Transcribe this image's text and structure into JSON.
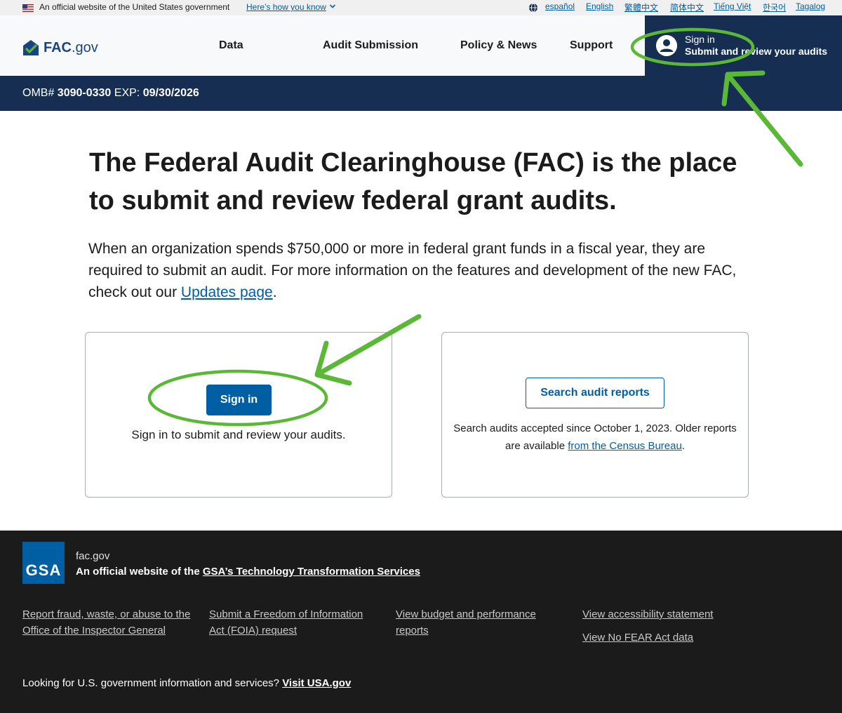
{
  "gov_banner": {
    "text": "An official website of the United States government",
    "link": "Here’s how you know",
    "languages": [
      "español",
      "English",
      "繁體中文",
      "简体中文",
      "Tiếng Việt",
      "한국어",
      "Tagalog"
    ]
  },
  "header": {
    "logo_main": "FAC",
    "logo_suffix": ".gov",
    "nav": [
      "Data",
      "Audit Submission",
      "Policy & News",
      "Support"
    ],
    "signin_line1": "Sign in",
    "signin_line2": "Submit and review your audits"
  },
  "omb": {
    "label": "OMB#",
    "number": "3090-0330",
    "exp_label": "EXP:",
    "exp_date": "09/30/2026"
  },
  "main": {
    "headline": "The Federal Audit Clearinghouse (FAC) is the place to submit and review federal grant audits.",
    "intro_text": "When an organization spends $750,000 or more in federal grant funds in a fiscal year, they are required to submit an audit. For more information on the features and development of the new FAC, check out our",
    "intro_link": "Updates page",
    "intro_end": ".",
    "signin_card": {
      "button": "Sign in",
      "text": "Sign in to submit and review your audits."
    },
    "search_card": {
      "button": "Search audit reports",
      "text": "Search audits accepted since October 1, 2023. Older reports are available",
      "link": "from the Census Bureau",
      "end": "."
    }
  },
  "footer": {
    "gsa_logo": "GSA",
    "domain": "fac.gov",
    "official_prefix": "An official website of the",
    "official_link": "GSA’s Technology Transformation Services",
    "links": [
      "Report fraud, waste, or abuse to the Office of the Inspector General",
      "Submit a Freedom of Information Act (FOIA) request",
      "View budget and performance reports",
      "View accessibility statement",
      "View No FEAR Act data"
    ],
    "bottom_text": "Looking for U.S. government information and services?",
    "bottom_link": "Visit USA.gov"
  },
  "colors": {
    "primary": "#005ea2",
    "navy": "#162e51",
    "annotation_green": "#5bb836",
    "footer_bg": "#1b1b1b"
  }
}
